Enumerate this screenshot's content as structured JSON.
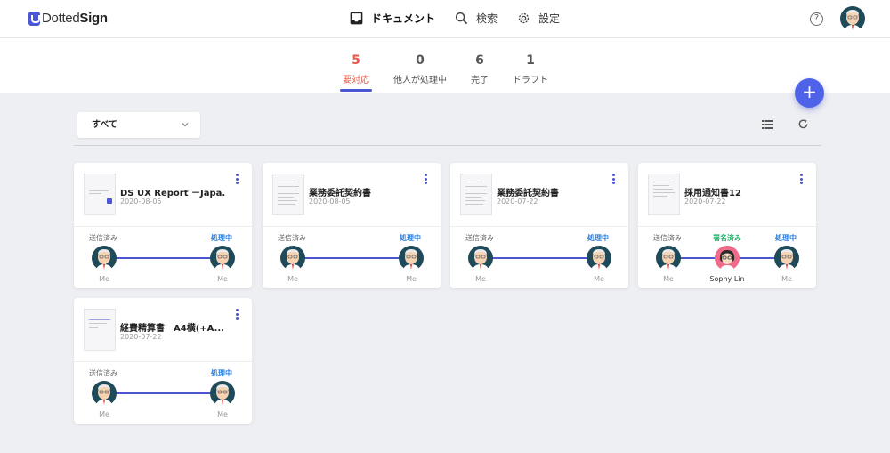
{
  "app": {
    "logo_text_light": "Dotted",
    "logo_text_bold": "Sign"
  },
  "nav": {
    "items": [
      {
        "label": "ドキュメント",
        "icon": "inbox-icon",
        "active": true
      },
      {
        "label": "検索",
        "icon": "search-icon",
        "active": false
      },
      {
        "label": "設定",
        "icon": "gear-icon",
        "active": false
      }
    ],
    "help_icon": "?"
  },
  "tabs": [
    {
      "count": "5",
      "label": "要対応",
      "active": true
    },
    {
      "count": "0",
      "label": "他人が処理中",
      "active": false
    },
    {
      "count": "6",
      "label": "完了",
      "active": false
    },
    {
      "count": "1",
      "label": "ドラフト",
      "active": false
    }
  ],
  "fab_label": "+",
  "filter": {
    "selected": "すべて"
  },
  "colors": {
    "accent": "#4a56d6",
    "attention": "#e8594c",
    "processing": "#2b7fe0",
    "signed": "#20b26a"
  },
  "documents": [
    {
      "title": "DS UX Report －Japa...",
      "date": "2020-08-05",
      "steps": [
        {
          "status": "送信済み",
          "who": "Me"
        },
        {
          "status": "処理中",
          "who": "Me"
        }
      ]
    },
    {
      "title": "業務委託契約書",
      "date": "2020-08-05",
      "steps": [
        {
          "status": "送信済み",
          "who": "Me"
        },
        {
          "status": "処理中",
          "who": "Me"
        }
      ]
    },
    {
      "title": "業務委託契約書",
      "date": "2020-07-22",
      "steps": [
        {
          "status": "送信済み",
          "who": "Me"
        },
        {
          "status": "処理中",
          "who": "Me"
        }
      ]
    },
    {
      "title": "採用通知書12",
      "date": "2020-07-22",
      "steps": [
        {
          "status": "送信済み",
          "who": "Me"
        },
        {
          "status": "署名済み",
          "who": "Sophy Lin"
        },
        {
          "status": "処理中",
          "who": "Me"
        }
      ]
    },
    {
      "title": "経費精算書　A4横(+A...",
      "date": "2020-07-22",
      "steps": [
        {
          "status": "送信済み",
          "who": "Me"
        },
        {
          "status": "処理中",
          "who": "Me"
        }
      ]
    }
  ]
}
